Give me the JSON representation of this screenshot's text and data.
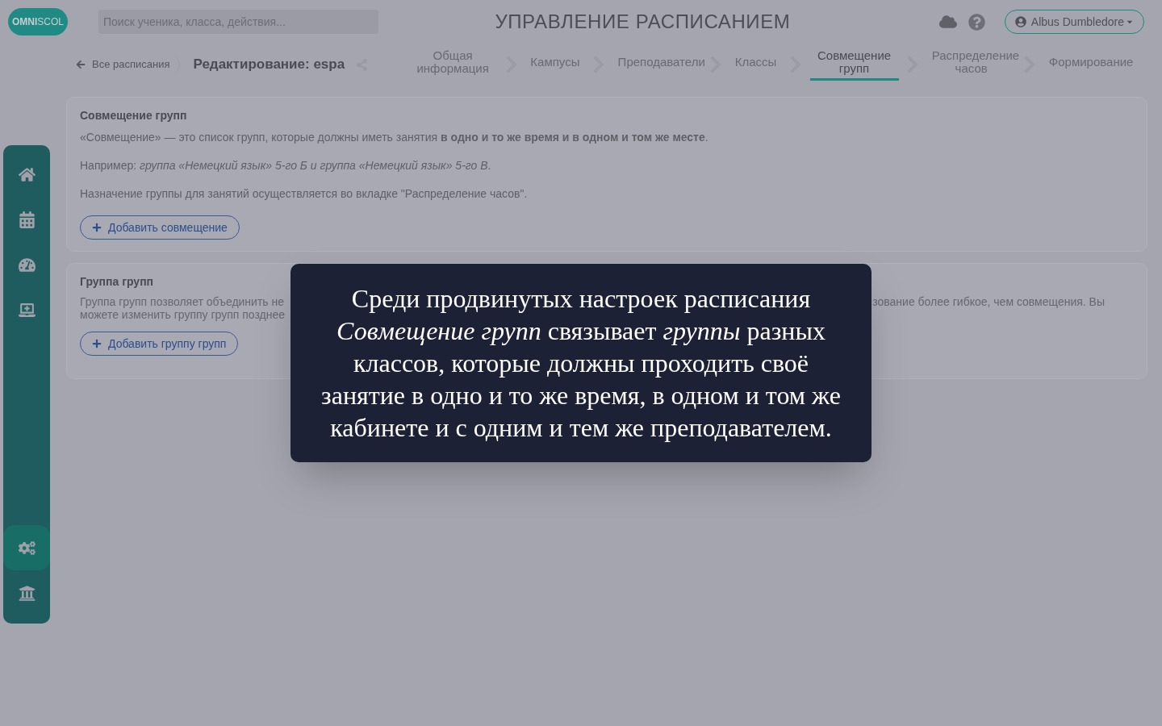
{
  "header": {
    "logo": {
      "bold": "OMNI",
      "light": "SCOL"
    },
    "search": {
      "placeholder": "Поиск ученика, класса, действия..."
    },
    "title": "УПРАВЛЕНИЕ РАСПИСАНИЕМ",
    "user": "Albus Dumbledore"
  },
  "breadcrumb": {
    "back": "Все расписания",
    "current": "Редактирование: espa"
  },
  "steps": [
    {
      "label": "Общая информация",
      "selected": false
    },
    {
      "label": "Кампусы",
      "selected": false
    },
    {
      "label": "Преподаватели",
      "selected": false
    },
    {
      "label": "Классы",
      "selected": false
    },
    {
      "label": "Совмещение групп",
      "selected": true
    },
    {
      "label": "Распределение часов",
      "selected": false
    },
    {
      "label": "Формирование",
      "selected": false
    }
  ],
  "sidebar": {
    "items": [
      {
        "selected": false
      },
      {
        "selected": false
      },
      {
        "selected": false
      },
      {
        "selected": false
      },
      {
        "selected": true
      },
      {
        "selected": false
      }
    ]
  },
  "cards": [
    {
      "title": "Совмещение групп",
      "paragraphs": [
        "«Совмещение» — это список групп, которые должны иметь занятия **в одно и то же время и в одном и том же месте**.",
        "Например: *группа «Немецкий язык» 5-го Б и группа «Немецкий язык» 5-го В*.",
        "Назначение группы для занятий осуществляется во вкладке \"Распределение часов\"."
      ],
      "button": "Добавить совмещение"
    },
    {
      "title": "Группа групп",
      "fragments_left": [
        "Группа групп позволяет объединить не",
        "можете изменить группу групп позднее"
      ],
      "fragments_right": [
        "зование более гибкое, чем совмещения. Вы"
      ],
      "button": "Добавить группу групп"
    }
  ],
  "caption": "Среди продвинутых настроек расписания *Совмещение групп* связывает *группы* разных классов, которые должны проходить своё занятие в одно и то же время, в одном и том же кабинете и с одним и тем же преподавателем."
}
